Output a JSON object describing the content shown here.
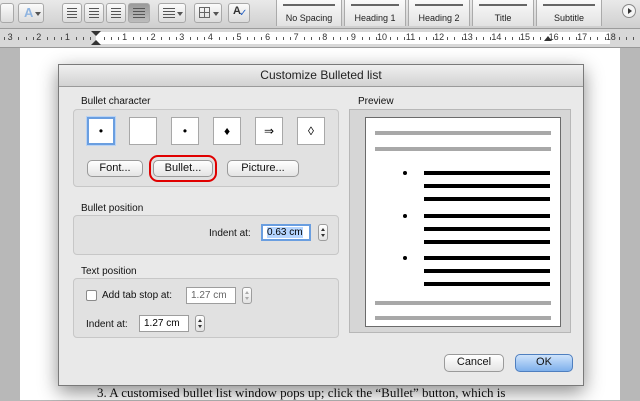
{
  "ribbon": {
    "styles": [
      "No Spacing",
      "Heading 1",
      "Heading 2",
      "Title",
      "Subtitle"
    ]
  },
  "ruler": {
    "numbers": [
      "3",
      "2",
      "1",
      "1",
      "2",
      "3",
      "4",
      "5",
      "6",
      "7",
      "8",
      "9",
      "10",
      "11",
      "12",
      "13",
      "14",
      "15",
      "16",
      "17",
      "18"
    ]
  },
  "document": {
    "caption": "3.  A customised bullet list window pops up; click the “Bullet” button, which is"
  },
  "dialog": {
    "title": "Customize Bulleted list",
    "bullet_character": {
      "label": "Bullet character",
      "cells": [
        "•",
        "",
        "•",
        "♦",
        "⇒",
        "◊"
      ],
      "buttons": {
        "font": "Font...",
        "bullet": "Bullet...",
        "picture": "Picture..."
      }
    },
    "bullet_position": {
      "label": "Bullet position",
      "indent_label": "Indent at:",
      "indent_value": "0.63 cm"
    },
    "text_position": {
      "label": "Text position",
      "tab_stop_label": "Add tab stop at:",
      "tab_stop_value": "1.27 cm",
      "indent_label": "Indent at:",
      "indent_value": "1.27 cm"
    },
    "preview": {
      "label": "Preview"
    },
    "cancel_label": "Cancel",
    "ok_label": "OK"
  },
  "colors": {
    "highlight": "#e00000",
    "focus": "#6a9ee0",
    "ok_button": "#7fb0ec"
  }
}
